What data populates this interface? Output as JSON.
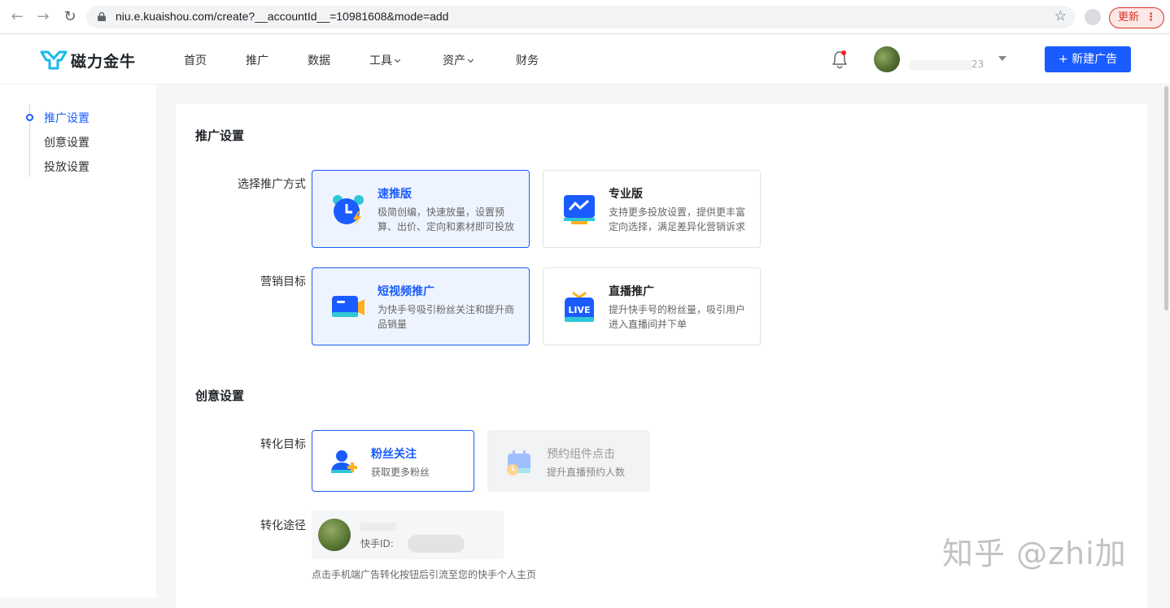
{
  "browser": {
    "url": "niu.e.kuaishou.com/create?__accountId__=10981608&mode=add",
    "update_label": "更新"
  },
  "app": {
    "logo_text": "磁力金牛",
    "nav": [
      {
        "label": "首页"
      },
      {
        "label": "推广"
      },
      {
        "label": "数据"
      },
      {
        "label": "工具"
      },
      {
        "label": "资产"
      },
      {
        "label": "财务"
      }
    ],
    "account_suffix": "23",
    "new_ad_label": "+ 新建广告"
  },
  "sidebar": {
    "items": [
      {
        "label": "推广设置"
      },
      {
        "label": "创意设置"
      },
      {
        "label": "投放设置"
      }
    ]
  },
  "promo": {
    "title": "推广设置",
    "method_label": "选择推广方式",
    "methods": [
      {
        "title": "速推版",
        "desc": "极简创编，快速放量，设置预算、出价、定向和素材即可投放"
      },
      {
        "title": "专业版",
        "desc": "支持更多投放设置，提供更丰富定向选择，满足差异化营销诉求"
      }
    ],
    "goal_label": "营销目标",
    "goals": [
      {
        "title": "短视频推广",
        "desc": "为快手号吸引粉丝关注和提升商品销量"
      },
      {
        "title": "直播推广",
        "desc": "提升快手号的粉丝量，吸引用户进入直播间并下单"
      }
    ]
  },
  "creative": {
    "title": "创意设置",
    "target_label": "转化目标",
    "targets": [
      {
        "title": "粉丝关注",
        "desc": "获取更多粉丝"
      },
      {
        "title": "预约组件点击",
        "desc": "提升直播预约人数"
      }
    ],
    "path_label": "转化途径",
    "path_id_label": "快手ID:",
    "path_hint": "点击手机端广告转化按钮后引流至您的快手个人主页"
  },
  "watermark": "知乎 @zhi加",
  "colors": {
    "accent": "#1a5cff",
    "selected_bg": "#eef4ff"
  }
}
